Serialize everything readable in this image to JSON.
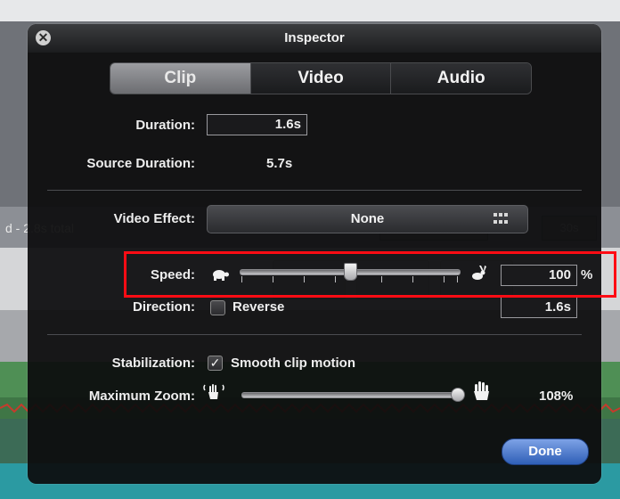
{
  "background": {
    "timeline_text": "d - 2.8s total",
    "timeline_duration": "30s"
  },
  "inspector": {
    "title": "Inspector",
    "tabs": [
      {
        "label": "Clip",
        "active": true
      },
      {
        "label": "Video",
        "active": false
      },
      {
        "label": "Audio",
        "active": false
      }
    ],
    "duration": {
      "label": "Duration:",
      "value": "1.6s"
    },
    "source_duration": {
      "label": "Source Duration:",
      "value": "5.7s"
    },
    "video_effect": {
      "label": "Video Effect:",
      "value": "None"
    },
    "speed": {
      "label": "Speed:",
      "value": "100",
      "unit": "%",
      "slider_level": 0.5,
      "slow_icon": "turtle-icon",
      "fast_icon": "rabbit-icon"
    },
    "direction": {
      "label": "Direction:",
      "checkbox_label": "Reverse",
      "checked": false,
      "value": "1.6s"
    },
    "stabilization": {
      "label": "Stabilization:",
      "checkbox_label": "Smooth clip motion",
      "checked": true,
      "checkmark": "✓"
    },
    "maximum_zoom": {
      "label": "Maximum Zoom:",
      "value": "108%",
      "slider_level": 0.95,
      "min_icon": "hand-small-icon",
      "max_icon": "hand-large-icon"
    },
    "done_label": "Done",
    "close_glyph": "✕"
  },
  "colors": {
    "highlight": "#ff0c14",
    "done_button": "#2f5fb7"
  }
}
